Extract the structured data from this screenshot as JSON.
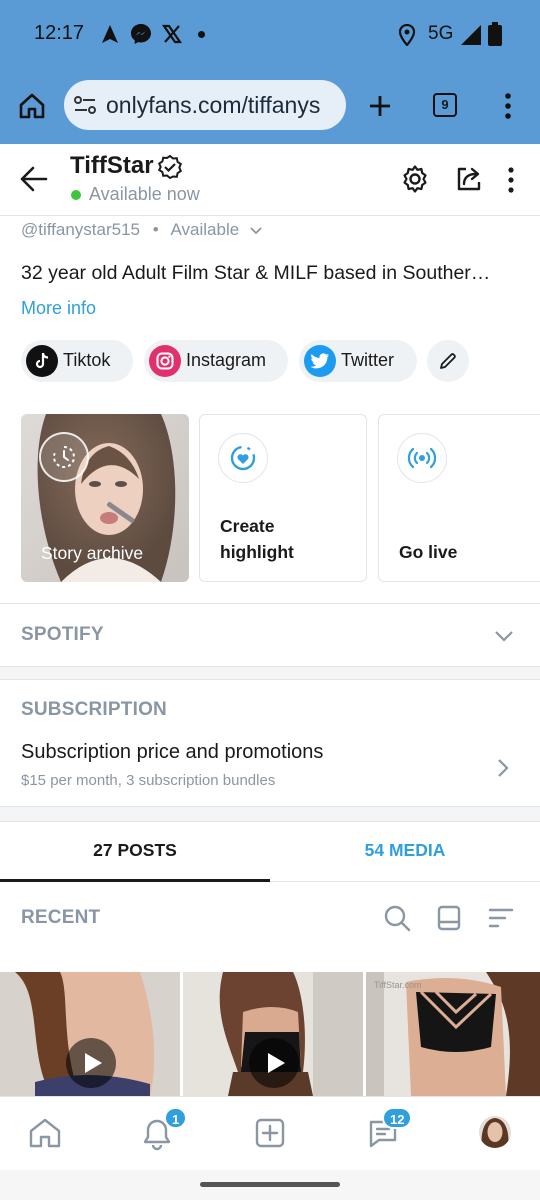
{
  "status_bar": {
    "time": "12:17",
    "network": "5G"
  },
  "browser": {
    "url": "onlyfans.com/tiffanys",
    "tab_count": "9"
  },
  "profile": {
    "name": "TiffStar",
    "availability": "Available now",
    "handle": "@tiffanystar515",
    "handle_status": "Available",
    "bio": "32 year old Adult Film Star & MILF based in Souther…",
    "more_info": "More info"
  },
  "social_chips": [
    {
      "label": "Tiktok",
      "icon": "tiktok-icon"
    },
    {
      "label": "Instagram",
      "icon": "instagram-icon"
    },
    {
      "label": "Twitter",
      "icon": "twitter-icon"
    }
  ],
  "highlight_cards": [
    {
      "label": "Story archive",
      "icon": "history-icon"
    },
    {
      "label": "Create highlight",
      "line1": "Create",
      "line2": "highlight",
      "icon": "heart-ring-icon"
    },
    {
      "label": "Go live",
      "icon": "broadcast-icon"
    }
  ],
  "spotify": {
    "title": "SPOTIFY"
  },
  "subscription": {
    "title": "SUBSCRIPTION",
    "item_label": "Subscription price and promotions",
    "item_sub": "$15 per month, 3 subscription bundles"
  },
  "tabs": [
    {
      "label": "27 POSTS",
      "active": true
    },
    {
      "label": "54 MEDIA",
      "active": false
    }
  ],
  "recent": {
    "title": "RECENT"
  },
  "tiles": [
    {
      "type": "video"
    },
    {
      "type": "video"
    },
    {
      "type": "image",
      "watermark": "TiffStar.com"
    }
  ],
  "bottom_nav": {
    "notifications_badge": "1",
    "messages_badge": "12"
  },
  "colors": {
    "accent": "#2f9fde",
    "status_bar": "#5b9bd5",
    "muted": "#8a96a3"
  }
}
